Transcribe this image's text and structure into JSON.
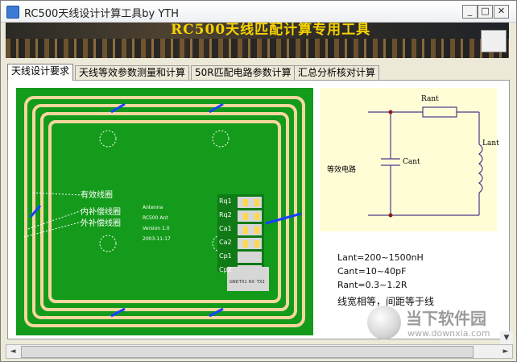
{
  "window": {
    "title": "RC500天线设计计算工具by YTH",
    "minimize": "_",
    "maximize": "□",
    "close": "✕"
  },
  "banner": {
    "text": "RC500天线匹配计算专用工具"
  },
  "tabs": [
    {
      "label": "天线设计要求",
      "active": true
    },
    {
      "label": "天线等效参数测量和计算",
      "active": false
    },
    {
      "label": "50R匹配电路参数计算",
      "active": false
    },
    {
      "label": "汇总分析核对计算",
      "active": false
    }
  ],
  "pcb": {
    "labels": [
      "有效线圈",
      "内补偿线圈",
      "外补偿线圈"
    ],
    "chip_text": [
      "Antenna",
      "RC500 Ant",
      "Version 1.0",
      "2003-11-17"
    ],
    "pad_labels": [
      "Rq1",
      "Rq2",
      "Ca1",
      "Ca2",
      "Cp1",
      "Cp2"
    ],
    "connector_labels": [
      "GND",
      "TX1",
      "RX",
      "TX2"
    ]
  },
  "circuit": {
    "labels": {
      "rant": "Rant",
      "lant": "Lant",
      "cant": "Cant",
      "source": "等效电路"
    }
  },
  "notes": [
    "Lant=200~1500nH",
    "Cant=10~40pF",
    "Rant=0.3~1.2R"
  ],
  "note_wide": "线宽相等，间距等于线",
  "watermark": {
    "title": "当下软件园",
    "url": "www.downxia.com"
  },
  "colors": {
    "pcb_green": "#149b1b",
    "trace": "#f5d79e",
    "banner_text": "#f5d200"
  },
  "scrollbar": {
    "left": "◄",
    "right": "►",
    "down": "▼"
  }
}
